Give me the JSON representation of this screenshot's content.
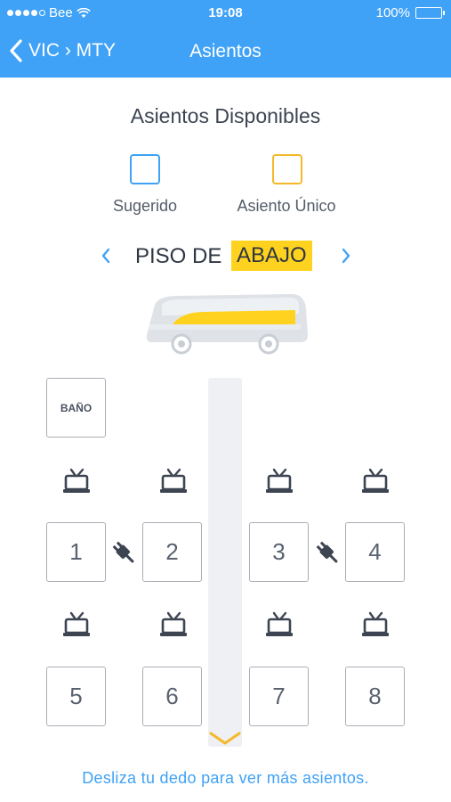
{
  "status_bar": {
    "carrier": "Bee",
    "time": "19:08",
    "battery": "100%",
    "signal_bars": 4
  },
  "nav": {
    "back_label": "VIC › MTY",
    "title": "Asientos"
  },
  "section_title": "Asientos Disponibles",
  "legend": [
    {
      "label": "Sugerido",
      "color": "#3fa2f6"
    },
    {
      "label": "Asiento Único",
      "color": "#f5b829"
    }
  ],
  "floor": {
    "prefix": "PISO DE",
    "highlight": "ABAJO",
    "prev_icon": "chevron-left-icon",
    "next_icon": "chevron-right-icon",
    "highlight_color": "#ffd21f"
  },
  "bathroom_label": "BAÑO",
  "seats": [
    "1",
    "2",
    "3",
    "4",
    "5",
    "6",
    "7",
    "8"
  ],
  "hint": "Desliza tu dedo para ver más asientos.",
  "colors": {
    "primary": "#3fa2f6",
    "accent": "#ffd21f"
  }
}
